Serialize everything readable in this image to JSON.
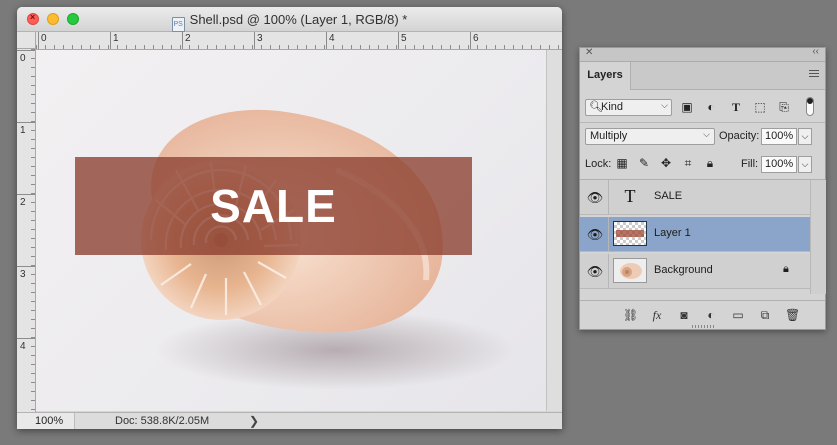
{
  "document": {
    "title": "Shell.psd @ 100% (Layer 1, RGB/8) *",
    "file_icon": "PS",
    "ruler_h_labels": [
      "0",
      "1",
      "2",
      "3",
      "4",
      "5",
      "6"
    ],
    "ruler_v_labels": [
      "0",
      "1",
      "2",
      "3",
      "4"
    ],
    "sale_text": "SALE",
    "zoom": "100%",
    "doc_info": "Doc: 538.8K/2.05M",
    "status_arrow": "❯"
  },
  "layers_panel": {
    "tab": "Layers",
    "filter_kind": "Kind",
    "blend_mode": "Multiply",
    "opacity_label": "Opacity:",
    "opacity_value": "100%",
    "lock_label": "Lock:",
    "fill_label": "Fill:",
    "fill_value": "100%",
    "layers": [
      {
        "name": "SALE",
        "kind": "text",
        "thumb_glyph": "T",
        "selected": false,
        "locked": false
      },
      {
        "name": "Layer 1",
        "kind": "pixel",
        "selected": true,
        "locked": false
      },
      {
        "name": "Background",
        "kind": "image",
        "selected": false,
        "locked": true
      }
    ],
    "footer_icons": [
      "link-icon",
      "fx-icon",
      "mask-icon",
      "adjustment-icon",
      "folder-icon",
      "new-layer-icon",
      "trash-icon"
    ]
  },
  "colors": {
    "workspace": "#7a7a7a",
    "selection": "#8aa5c9",
    "sale_band": "#8c3f30"
  }
}
